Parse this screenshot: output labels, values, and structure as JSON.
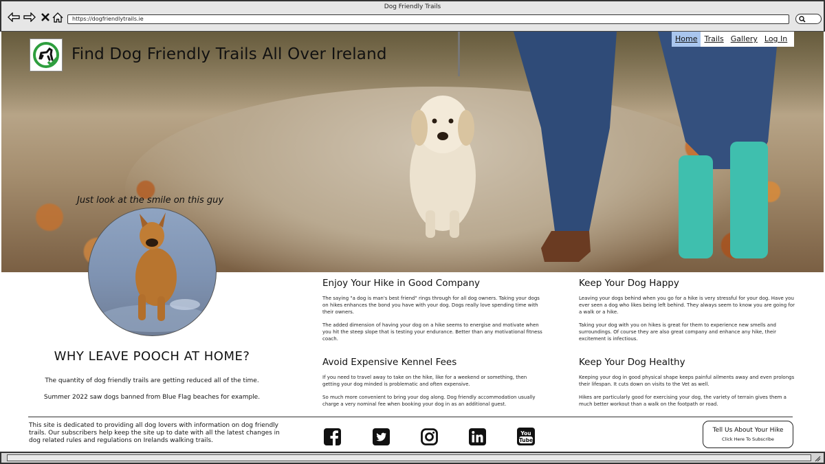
{
  "browser": {
    "window_title": "Dog Friendly Trails",
    "url": "https://dogfriendlytrails.ie"
  },
  "site": {
    "title": "Find Dog Friendly Trails All Over Ireland",
    "logo_icon": "dog-walk-check-icon"
  },
  "nav": {
    "items": [
      {
        "label": "Home",
        "active": true
      },
      {
        "label": "Trails",
        "active": false
      },
      {
        "label": "Gallery",
        "active": false
      },
      {
        "label": "Log In",
        "active": false
      }
    ]
  },
  "hero": {
    "caption": "Just look at the smile on this guy"
  },
  "why": {
    "heading": "WHY LEAVE POOCH AT HOME?",
    "line1": "The quantity of dog friendly trails are getting reduced all of the time.",
    "line2": "Summer 2022 saw dogs banned from Blue Flag beaches for example."
  },
  "sections": [
    {
      "title": "Enjoy Your Hike in Good Company",
      "paragraphs": [
        "The saying \"a dog is man's best friend\" rings through for all dog owners. Taking your dogs on hikes enhances the bond you have with your dog. Dogs really love  spending time with their owners.",
        "The added dimension of having your dog on a hike seems to energise and motivate when you hit the steep slope that is testing your endurance. Better than any motivational fitness coach."
      ]
    },
    {
      "title": "Keep Your Dog Happy",
      "paragraphs": [
        "Leaving your dogs behind when you go for a hike is very stressful for your dog. Have you ever seen a dog who likes being left behind. They always seem to know you are going for a walk or a hike.",
        "Taking your dog with you on hikes is great for them to experience new smells and surroundings. Of course they are also great company and enhance any hike, their excitement is infectious."
      ]
    },
    {
      "title": "Avoid Expensive Kennel Fees",
      "paragraphs": [
        "If you need to travel away to take on the hike, like for a weekend or something, then getting your dog minded is problematic and often expensive.",
        "So much more convenient to bring your dog along. Dog friendly accommodation usually charge a very nominal fee when booking your dog in as an additional guest."
      ]
    },
    {
      "title": "Keep Your Dog Healthy",
      "paragraphs": [
        "Keeping your dog in good physical shape keeps painful ailments away and even prolongs their lifespan. It cuts down on visits to the Vet as well.",
        "Hikes are particularly good for exercising your dog, the variety of terrain gives them a much better workout than a walk on the footpath or road."
      ]
    }
  ],
  "footer": {
    "text": "This site is dedicated to providing all dog lovers with information on dog friendly trails.  Our subscribers help keep the site up to date with all the latest changes in dog related rules and regulations on Irelands walking trails.",
    "socials": [
      "facebook-icon",
      "twitter-icon",
      "instagram-icon",
      "linkedin-icon",
      "youtube-icon"
    ],
    "cta_main": "Tell Us About Your Hike",
    "cta_sub": "Click Here To Subscribe"
  },
  "colors": {
    "nav_active": "#a9c6ee",
    "logo_green": "#2e9e3e",
    "chrome": "#e6e6e6"
  }
}
